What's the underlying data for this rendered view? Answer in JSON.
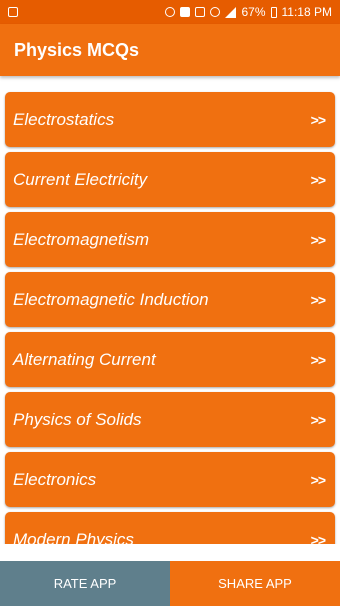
{
  "status_bar": {
    "battery": "67%",
    "time": "11:18 PM",
    "icons": [
      "image-icon",
      "alarm-icon",
      "nfc-icon",
      "no-sim-icon",
      "wifi-icon",
      "signal-icon",
      "battery-icon"
    ]
  },
  "app_bar": {
    "title": "Physics MCQs"
  },
  "list": {
    "arrow": ">>",
    "items": [
      {
        "label": "Electrostatics"
      },
      {
        "label": "Current Electricity"
      },
      {
        "label": "Electromagnetism"
      },
      {
        "label": "Electromagnetic Induction"
      },
      {
        "label": "Alternating Current"
      },
      {
        "label": "Physics of Solids"
      },
      {
        "label": "Electronics"
      },
      {
        "label": "Modern Physics"
      }
    ]
  },
  "bottom_bar": {
    "rate_label": "RATE APP",
    "share_label": "SHARE APP"
  },
  "colors": {
    "accent": "#f07010",
    "status_bar": "#e65c00",
    "rate_button": "#5f7f8c"
  }
}
